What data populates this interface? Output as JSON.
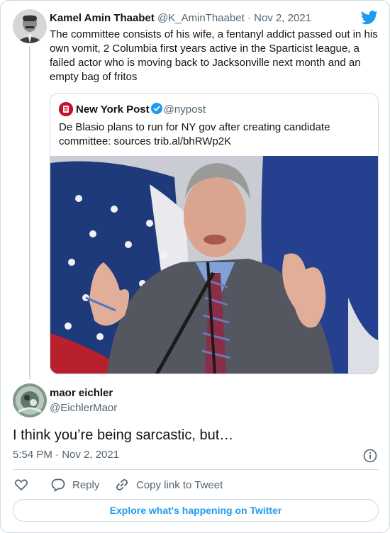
{
  "tweet": {
    "author_name": "Kamel Amin Thaabet",
    "author_handle": "@K_AminThaabet",
    "separator": "·",
    "date": "Nov 2, 2021",
    "text": "The committee consists of his wife, a fentanyl addict passed out in his own vomit, 2 Columbia first years active in the Sparticist league, a failed actor who is moving back to Jacksonville next month and an empty bag of fritos"
  },
  "quoted": {
    "author_name": "New York Post",
    "author_handle": "@nypost",
    "text": "De Blasio plans to run for NY gov after creating candidate committee: sources trib.al/bhRWp2K"
  },
  "reply": {
    "author_name": "maor eichler",
    "author_handle": "@EichlerMaor",
    "text": "I think you’re being sarcastic, but…",
    "timestamp": "5:54 PM · Nov 2, 2021"
  },
  "actions": {
    "reply_label": "Reply",
    "copy_label": "Copy link to Tweet"
  },
  "footer": {
    "explore_label": "Explore what's happening on Twitter"
  },
  "colors": {
    "accent": "#1d9bf0",
    "muted": "#536471",
    "border": "#cfd9de"
  },
  "icons": [
    "twitter-bird-icon",
    "verified-badge-icon",
    "info-icon",
    "heart-icon",
    "reply-bubble-icon",
    "link-icon"
  ]
}
